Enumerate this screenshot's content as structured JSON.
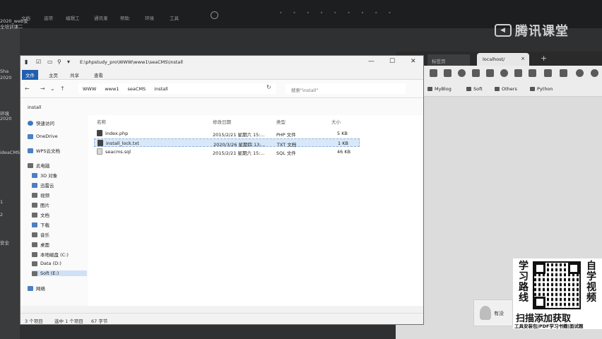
{
  "desktop": {
    "menu_items": [
      "文档",
      "选项",
      "编辑工",
      "通讯录",
      "帮助",
      "环境",
      "工具"
    ],
    "left_labels": [
      "2020_web安",
      "全培训课二",
      "Sha",
      "2020",
      "环境",
      "2020",
      "ideaCMS",
      "1",
      "2",
      "安全"
    ]
  },
  "logo": {
    "mark": "◀",
    "text": "腾讯课堂"
  },
  "browser": {
    "tab_a": "标签页",
    "tab_b": "localhost/",
    "tab_close": "×",
    "new_tab": "+",
    "bookmarks": [
      "MyBlog",
      "Soft",
      "Others",
      "Python"
    ]
  },
  "explorer": {
    "title_path": "E:\\phpstudy_pro\\WWW\\www1\\seaCMS\\install",
    "window_buttons": [
      "—",
      "☐",
      "✕"
    ],
    "ribbon_tabs": [
      "文件",
      "主页",
      "共享",
      "查看"
    ],
    "nav_symbols": {
      "back": "←",
      "forward": "→",
      "up": "↑",
      "refresh": "↻",
      "dropdown": "⌄"
    },
    "address_parts": [
      "WWW",
      "www1",
      "seaCMS",
      "install"
    ],
    "search_placeholder": "搜索\"install\"",
    "path_tab": "install",
    "sidebar": [
      "快速访问",
      "OneDrive",
      "WPS云文档",
      "此电脑",
      "3D 对象",
      "迅雷云",
      "视频",
      "图片",
      "文档",
      "下载",
      "音乐",
      "桌面",
      "本地磁盘 (C:)",
      "Data (D:)",
      "Soft (E:)",
      "网络"
    ],
    "columns": [
      "名称",
      "修改日期",
      "类型",
      "大小"
    ],
    "files": [
      {
        "name": "index.php",
        "date": "2015/2/21 星期六 15:...",
        "type": "PHP 文件",
        "size": "5 KB"
      },
      {
        "name": "install_lock.txt",
        "date": "2020/3/26 星期四 13:...",
        "type": "TXT 文档",
        "size": "1 KB"
      },
      {
        "name": "seacms.sql",
        "date": "2015/2/21 星期六 15:...",
        "type": "SQL 文件",
        "size": "46 KB"
      }
    ],
    "status": {
      "count": "3 个项目",
      "selection": "选中 1 个项目",
      "size": "67 字节"
    }
  },
  "promo": {
    "left_chars": [
      "学",
      "习",
      "路",
      "线"
    ],
    "right_chars": [
      "自",
      "学",
      "视",
      "频"
    ],
    "line1": "扫描添加获取",
    "line2": "工具安装包|PDF学习书籍|面试题"
  },
  "avatar_card": {
    "label": "有没"
  }
}
